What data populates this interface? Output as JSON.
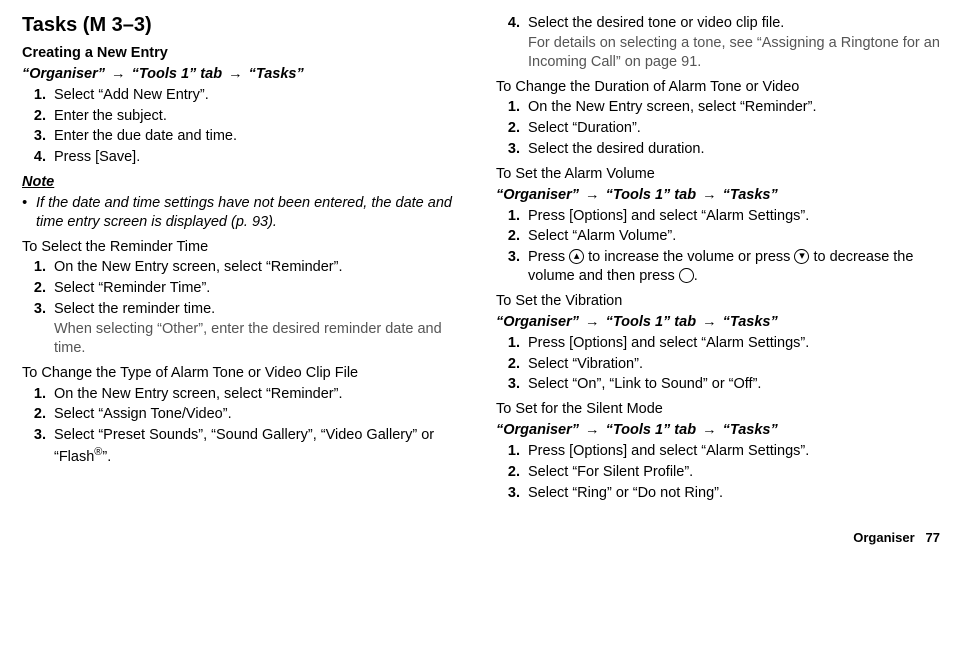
{
  "left": {
    "title": "Tasks (M 3–3)",
    "creating_heading": "Creating a New Entry",
    "nav": "“Organiser” → “Tools 1” tab → “Tasks”",
    "steps1": [
      "Select “Add New Entry”.",
      "Enter the subject.",
      "Enter the due date and time.",
      "Press [Save]."
    ],
    "note_label": "Note",
    "note_text": "If the date and time settings have not been entered, the date and time entry screen is displayed (p. 93).",
    "reminder_heading": "To Select the Reminder Time",
    "steps2": [
      {
        "text": "On the New Entry screen, select “Reminder”."
      },
      {
        "text": "Select “Reminder Time”."
      },
      {
        "text": "Select the reminder time.",
        "sub": "When selecting “Other”, enter the desired reminder date and time."
      }
    ],
    "tone_heading": "To Change the Type of Alarm Tone or Video Clip File",
    "steps3": [
      "On the New Entry screen, select “Reminder”.",
      "Select “Assign Tone/Video”.",
      "Select “Preset Sounds”, “Sound Gallery”, “Video Gallery” or “Flash®”."
    ]
  },
  "right": {
    "step4_text": "Select the desired tone or video clip file.",
    "step4_sub": "For details on selecting a tone, see “Assigning a Ringtone for an Incoming Call” on page 91.",
    "duration_heading": "To Change the Duration of Alarm Tone or Video",
    "steps_dur": [
      "On the New Entry screen, select “Reminder”.",
      "Select “Duration”.",
      "Select the desired duration."
    ],
    "volume_heading": "To Set the Alarm Volume",
    "nav": "“Organiser” → “Tools 1” tab → “Tasks”",
    "steps_vol": [
      "Press [Options] and select “Alarm Settings”.",
      "Select “Alarm Volume”.",
      "Press ▲ to increase the volume or press ▼ to decrease the volume and then press ◯."
    ],
    "vib_heading": "To Set the Vibration",
    "steps_vib": [
      "Press [Options] and select “Alarm Settings”.",
      "Select “Vibration”.",
      "Select “On”, “Link to Sound” or “Off”."
    ],
    "silent_heading": "To Set for the Silent Mode",
    "steps_silent": [
      "Press [Options] and select “Alarm Settings”.",
      "Select “For Silent Profile”.",
      "Select “Ring” or “Do not Ring”."
    ]
  },
  "footer": {
    "section": "Organiser",
    "page": "77"
  }
}
